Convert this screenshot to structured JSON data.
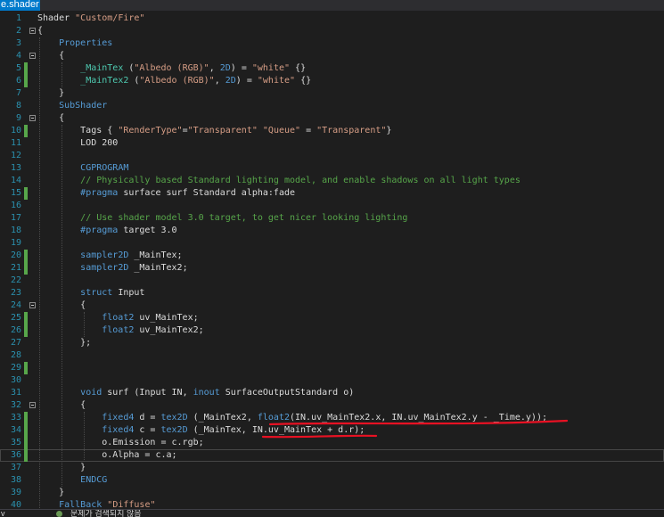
{
  "tab": {
    "label": "e.shader"
  },
  "status": {
    "zoom": "v",
    "message": "문제가 검색되지 않음"
  },
  "editor": {
    "lines": [
      {
        "n": "1",
        "text": "Shader \"Custom/Fire\""
      },
      {
        "n": "2",
        "text": "{"
      },
      {
        "n": "3",
        "text": "    Properties"
      },
      {
        "n": "4",
        "text": "    {"
      },
      {
        "n": "5",
        "text": "        _MainTex (\"Albedo (RGB)\", 2D) = \"white\" {}"
      },
      {
        "n": "6",
        "text": "        _MainTex2 (\"Albedo (RGB)\", 2D) = \"white\" {}"
      },
      {
        "n": "7",
        "text": "    }"
      },
      {
        "n": "8",
        "text": "    SubShader"
      },
      {
        "n": "9",
        "text": "    {"
      },
      {
        "n": "10",
        "text": "        Tags { \"RenderType\"=\"Transparent\" \"Queue\" = \"Transparent\"}"
      },
      {
        "n": "11",
        "text": "        LOD 200"
      },
      {
        "n": "12",
        "text": ""
      },
      {
        "n": "13",
        "text": "        CGPROGRAM"
      },
      {
        "n": "14",
        "text": "        // Physically based Standard lighting model, and enable shadows on all light types"
      },
      {
        "n": "15",
        "text": "        #pragma surface surf Standard alpha:fade"
      },
      {
        "n": "16",
        "text": ""
      },
      {
        "n": "17",
        "text": "        // Use shader model 3.0 target, to get nicer looking lighting"
      },
      {
        "n": "18",
        "text": "        #pragma target 3.0"
      },
      {
        "n": "19",
        "text": ""
      },
      {
        "n": "20",
        "text": "        sampler2D _MainTex;"
      },
      {
        "n": "21",
        "text": "        sampler2D _MainTex2;"
      },
      {
        "n": "22",
        "text": ""
      },
      {
        "n": "23",
        "text": "        struct Input"
      },
      {
        "n": "24",
        "text": "        {"
      },
      {
        "n": "25",
        "text": "            float2 uv_MainTex;"
      },
      {
        "n": "26",
        "text": "            float2 uv_MainTex2;"
      },
      {
        "n": "27",
        "text": "        };"
      },
      {
        "n": "28",
        "text": ""
      },
      {
        "n": "29",
        "text": ""
      },
      {
        "n": "30",
        "text": ""
      },
      {
        "n": "31",
        "text": "        void surf (Input IN, inout SurfaceOutputStandard o)"
      },
      {
        "n": "32",
        "text": "        {"
      },
      {
        "n": "33",
        "text": "            fixed4 d = tex2D (_MainTex2, float2(IN.uv_MainTex2.x, IN.uv_MainTex2.y - _Time.y));"
      },
      {
        "n": "34",
        "text": "            fixed4 c = tex2D (_MainTex, IN.uv_MainTex + d.r);"
      },
      {
        "n": "35",
        "text": "            o.Emission = c.rgb;"
      },
      {
        "n": "36",
        "text": "            o.Alpha = c.a;"
      },
      {
        "n": "37",
        "text": "        }"
      },
      {
        "n": "38",
        "text": "        ENDCG"
      },
      {
        "n": "39",
        "text": "    }"
      },
      {
        "n": "40",
        "text": "    FallBack \"Diffuse\""
      }
    ]
  }
}
